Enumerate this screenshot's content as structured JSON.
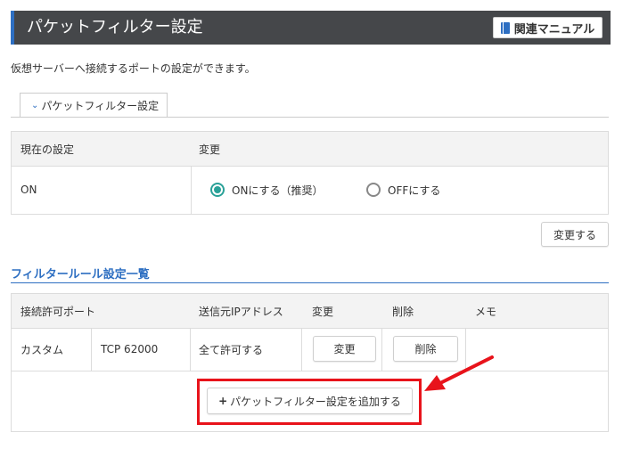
{
  "header": {
    "title": "パケットフィルター設定",
    "manual_label": "関連マニュアル"
  },
  "description": "仮想サーバーへ接続するポートの設定ができます。",
  "tab": {
    "chevron": "⌄",
    "label": "パケットフィルター設定"
  },
  "settings": {
    "col_current": "現在の設定",
    "col_change": "変更",
    "current_value": "ON",
    "options": [
      {
        "label": "ONにする（推奨）",
        "checked": true
      },
      {
        "label": "OFFにする",
        "checked": false
      }
    ],
    "apply_label": "変更する"
  },
  "rules": {
    "title": "フィルタールール設定一覧",
    "headers": {
      "port": "接続許可ポート",
      "source": "送信元IPアドレス",
      "change": "変更",
      "delete": "削除",
      "memo": "メモ"
    },
    "rows": [
      {
        "type": "カスタム",
        "port": "TCP 62000",
        "source": "全て許可する",
        "change_label": "変更",
        "delete_label": "削除",
        "memo": ""
      }
    ],
    "add_label": "パケットフィルター設定を追加する",
    "add_icon": "+"
  },
  "colors": {
    "accent": "#2e6fc2",
    "header_bg": "#45474a",
    "radio_checked": "#2aa198",
    "highlight": "#e8131b"
  }
}
